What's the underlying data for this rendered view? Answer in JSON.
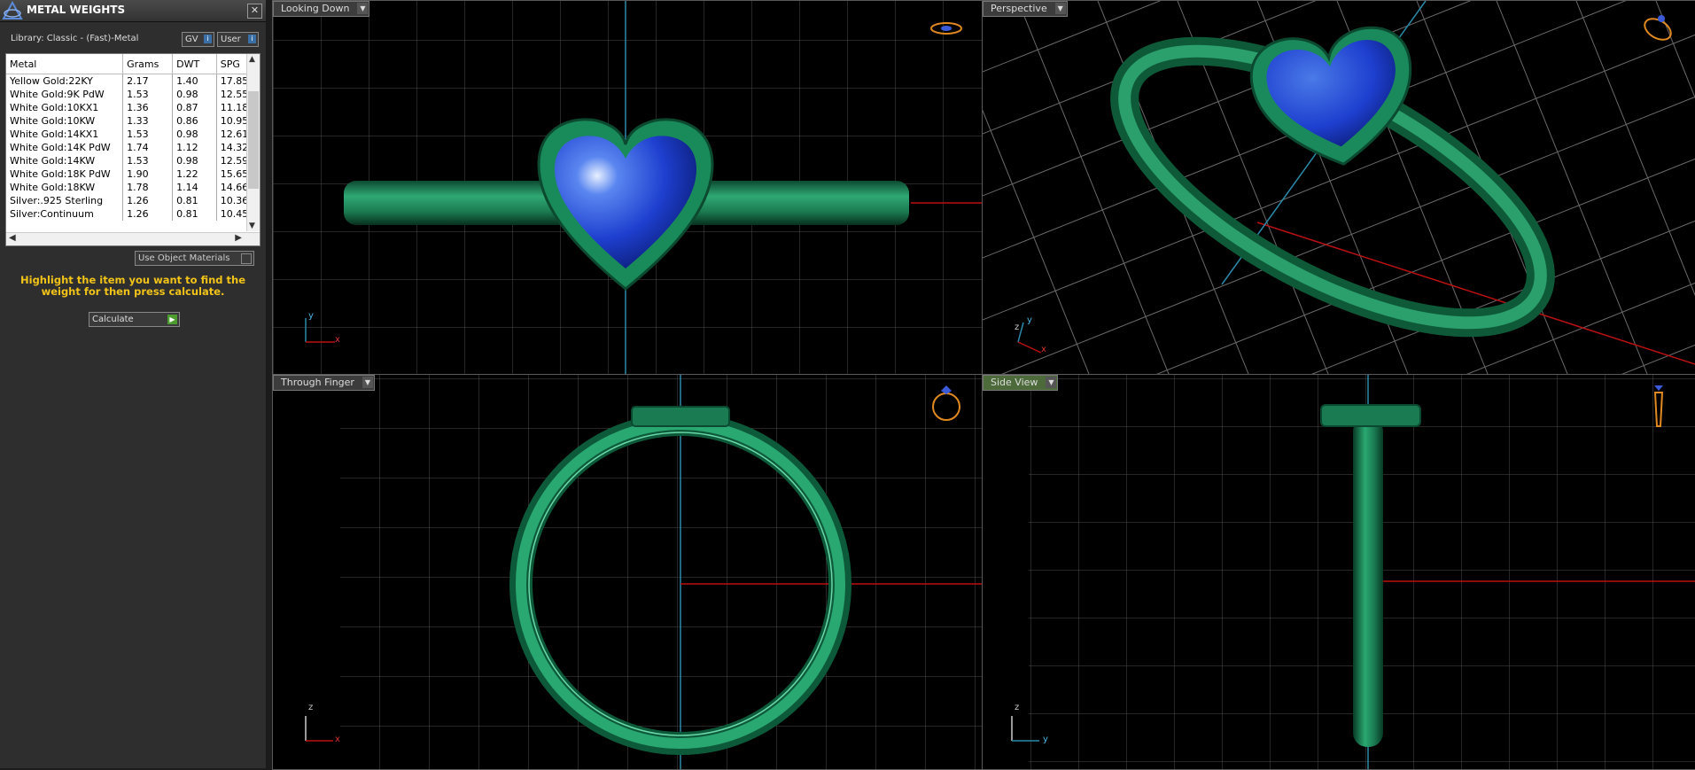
{
  "panel": {
    "title": "METAL WEIGHTS",
    "close": "✕",
    "library": "Library: Classic - (Fast)-Metal",
    "gv_label": "GV",
    "user_label": "User",
    "table": {
      "headers": [
        "Metal",
        "Grams",
        "DWT",
        "SPG"
      ],
      "rows": [
        [
          "Yellow Gold:22KY",
          "2.17",
          "1.40",
          "17.85"
        ],
        [
          "White Gold:9K PdW",
          "1.53",
          "0.98",
          "12.55"
        ],
        [
          "White Gold:10KX1",
          "1.36",
          "0.87",
          "11.18"
        ],
        [
          "White Gold:10KW",
          "1.33",
          "0.86",
          "10.95"
        ],
        [
          "White Gold:14KX1",
          "1.53",
          "0.98",
          "12.61"
        ],
        [
          "White Gold:14K PdW",
          "1.74",
          "1.12",
          "14.32"
        ],
        [
          "White Gold:14KW",
          "1.53",
          "0.98",
          "12.59"
        ],
        [
          "White Gold:18K PdW",
          "1.90",
          "1.22",
          "15.65"
        ],
        [
          "White Gold:18KW",
          "1.78",
          "1.14",
          "14.66"
        ],
        [
          "Silver:.925 Sterling",
          "1.26",
          "0.81",
          "10.36"
        ],
        [
          "Silver:Continuum",
          "1.26",
          "0.81",
          "10.45"
        ]
      ]
    },
    "use_object_materials": "Use Object Materials",
    "hint": "Highlight the item you want to find the weight for then press calculate.",
    "calculate": "Calculate"
  },
  "viewports": {
    "top_left": "Looking Down",
    "top_right": "Perspective",
    "bottom_left": "Through Finger",
    "bottom_right": "Side View"
  },
  "axis_labels": {
    "x": "x",
    "y": "y",
    "z": "z"
  },
  "colors": {
    "ring_green": "#1f8a5c",
    "stone_blue": "#1e3fcf",
    "grid": "#5a5a5a",
    "x_axis": "#b11",
    "y_axis": "#2a8aa8",
    "hint_yellow": "#f2c318"
  }
}
